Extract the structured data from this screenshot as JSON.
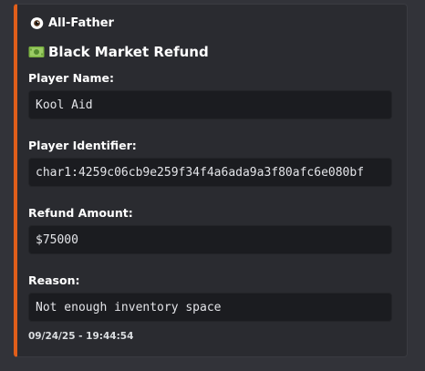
{
  "embed": {
    "accent_color": "#e05e1a",
    "author": {
      "icon": "eye-icon",
      "name": "All-Father"
    },
    "title": {
      "icon": "money-icon",
      "text": "Black Market Refund"
    },
    "fields": [
      {
        "name": "Player Name:",
        "value": "Kool Aid"
      },
      {
        "name": "Player Identifier:",
        "value": "char1:4259c06cb9e259f34f4a6ada9a3f80afc6e080bf"
      },
      {
        "name": "Refund Amount:",
        "value": "$75000"
      },
      {
        "name": "Reason:",
        "value": "Not enough inventory space"
      }
    ],
    "footer": {
      "timestamp": "09/24/25 - 19:44:54"
    }
  }
}
